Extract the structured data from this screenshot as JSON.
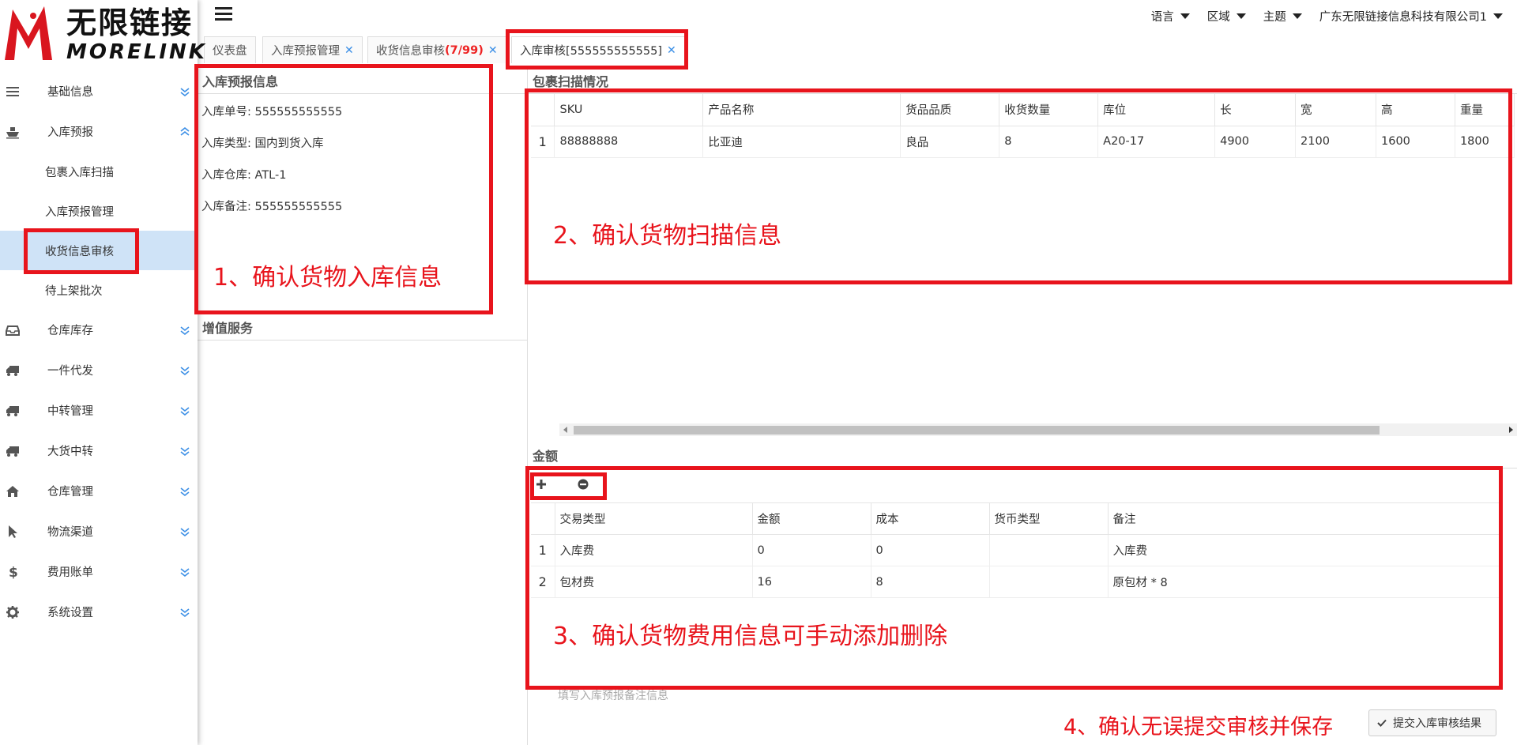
{
  "logo": {
    "cn": "无限链接",
    "en": "MORELINK"
  },
  "sidebar": {
    "items": [
      {
        "label": "基础信息",
        "icon": "list-icon",
        "expanded": false
      },
      {
        "label": "入库预报",
        "icon": "ship-icon",
        "expanded": true,
        "children": [
          "包裹入库扫描",
          "入库预报管理",
          "收货信息审核",
          "待上架批次"
        ]
      },
      {
        "label": "仓库库存",
        "icon": "inbox-icon",
        "expanded": false
      },
      {
        "label": "一件代发",
        "icon": "truck-icon",
        "expanded": false
      },
      {
        "label": "中转管理",
        "icon": "truck-icon",
        "expanded": false
      },
      {
        "label": "大货中转",
        "icon": "truck-icon",
        "expanded": false
      },
      {
        "label": "仓库管理",
        "icon": "home-icon",
        "expanded": false
      },
      {
        "label": "物流渠道",
        "icon": "cursor-icon",
        "expanded": false
      },
      {
        "label": "费用账单",
        "icon": "dollar-icon",
        "expanded": false
      },
      {
        "label": "系统设置",
        "icon": "gear-icon",
        "expanded": false
      }
    ]
  },
  "topbar": {
    "language": "语言",
    "region": "区域",
    "theme": "主题",
    "company": "广东无限链接信息科技有限公司1"
  },
  "tabs": [
    {
      "label": "仪表盘",
      "closable": false
    },
    {
      "label": "入库预报管理",
      "closable": true
    },
    {
      "label": "收货信息审核",
      "count": "(7/99)",
      "closable": true
    },
    {
      "label": "入库审核[555555555555]",
      "closable": true,
      "active": true
    }
  ],
  "inbound_info": {
    "title": "入库预报信息",
    "order_no": "入库单号: 555555555555",
    "type": "入库类型: 国内到货入库",
    "warehouse": "入库仓库: ATL-1",
    "remark": "入库备注: 555555555555"
  },
  "value_added": {
    "title": "增值服务"
  },
  "scan": {
    "title": "包裹扫描情况",
    "columns": [
      "SKU",
      "产品名称",
      "货品品质",
      "收货数量",
      "库位",
      "长",
      "宽",
      "高",
      "重量"
    ],
    "rows": [
      {
        "no": "1",
        "cells": [
          "88888888",
          "比亚迪",
          "良品",
          "8",
          "A20-17",
          "4900",
          "2100",
          "1600",
          "1800"
        ]
      }
    ]
  },
  "amount": {
    "title": "金额",
    "columns": [
      "交易类型",
      "金额",
      "成本",
      "货币类型",
      "备注"
    ],
    "rows": [
      {
        "no": "1",
        "cells": [
          "入库费",
          "0",
          "0",
          "",
          "入库费"
        ]
      },
      {
        "no": "2",
        "cells": [
          "包材费",
          "16",
          "8",
          "",
          "原包材 * 8"
        ]
      }
    ]
  },
  "remark_placeholder": "填写入库预报备注信息",
  "submit_label": "提交入库审核结果",
  "annotations": {
    "a1": "1、确认货物入库信息",
    "a2": "2、确认货物扫描信息",
    "a3": "3、确认货物费用信息可手动添加删除",
    "a4": "4、确认无误提交审核并保存"
  },
  "colors": {
    "annotation_red": "#e8141c",
    "active_menu": "#cfe3f7",
    "tab_close": "#3a8ee6"
  }
}
